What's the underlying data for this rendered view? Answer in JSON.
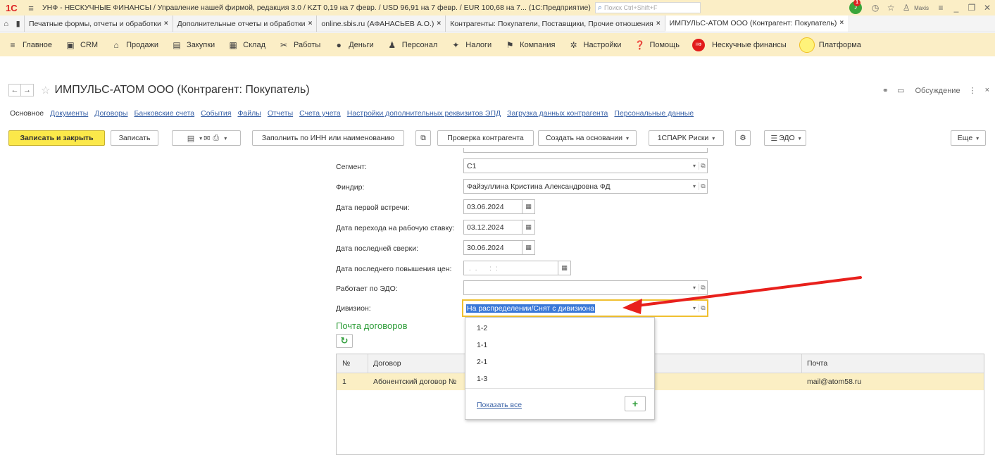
{
  "titlebar": {
    "app_logo": "1С",
    "text": "УНФ - НЕСКУЧНЫЕ ФИНАНСЫ / Управление нашей фирмой, редакция 3.0 / KZT 0,19 на 7 февр. / USD 96,91 на 7 февр. / EUR 100,68 на 7...  (1С:Предприятие)",
    "search_placeholder": "Поиск Ctrl+Shift+F",
    "notification_count": "1",
    "user": "Maxis"
  },
  "tabs": [
    {
      "label": "Печатные формы, отчеты и обработки"
    },
    {
      "label": "Дополнительные отчеты и обработки"
    },
    {
      "label": "online.sbis.ru (АФАНАСЬЕВ А.О.)"
    },
    {
      "label": "Контрагенты: Покупатели, Поставщики, Прочие отношения"
    },
    {
      "label": "ИМПУЛЬС-АТОМ ООО (Контрагент: Покупатель)"
    }
  ],
  "sections": [
    {
      "label": "Главное"
    },
    {
      "label": "CRM"
    },
    {
      "label": "Продажи"
    },
    {
      "label": "Закупки"
    },
    {
      "label": "Склад"
    },
    {
      "label": "Работы"
    },
    {
      "label": "Деньги"
    },
    {
      "label": "Персонал"
    },
    {
      "label": "Налоги"
    },
    {
      "label": "Компания"
    },
    {
      "label": "Настройки"
    },
    {
      "label": "Помощь"
    },
    {
      "label": "Нескучные финансы",
      "badge": "НФ"
    },
    {
      "label": "Платформа"
    }
  ],
  "form": {
    "title": "ИМПУЛЬС-АТОМ ООО (Контрагент: Покупатель)",
    "discussion": "Обсуждение"
  },
  "subnav": {
    "current": "Основное",
    "links": [
      "Документы",
      "Договоры",
      "Банковские счета",
      "События",
      "Файлы",
      "Отчеты",
      "Счета учета",
      "Настройки дополнительных реквизитов ЭПД",
      "Загрузка данных контрагента",
      "Персональные данные"
    ]
  },
  "toolbar": {
    "save_close": "Записать и закрыть",
    "save": "Записать",
    "fill_inn": "Заполнить по ИНН или наименованию",
    "check": "Проверка контрагента",
    "create_based": "Создать на основании",
    "spark": "1СПАРК Риски",
    "edo": "ЭДО",
    "more": "Еще"
  },
  "fields": {
    "segment": {
      "label": "Сегмент:",
      "value": "С1"
    },
    "findir": {
      "label": "Финдир:",
      "value": "Файзуллина Кристина Александровна ФД"
    },
    "first_meeting": {
      "label": "Дата первой встречи:",
      "value": "03.06.2024"
    },
    "work_rate": {
      "label": "Дата перехода на рабочую ставку:",
      "value": "03.12.2024"
    },
    "last_reconcile": {
      "label": "Дата последней сверки:",
      "value": "30.06.2024"
    },
    "last_price_raise": {
      "label": "Дата последнего повышения цен:",
      "value": " .  .      :  :"
    },
    "edo_works": {
      "label": "Работает по ЭДО:",
      "value": ""
    },
    "division": {
      "label": "Дивизион:",
      "value": "На распределении/Снят с дивизиона"
    }
  },
  "contracts": {
    "title": "Почта договоров",
    "columns": [
      "№",
      "Договор",
      "Почта"
    ],
    "rows": [
      {
        "n": "1",
        "contract": "Абонентский договор №",
        "email": "mail@atom58.ru"
      }
    ]
  },
  "dropdown": {
    "items": [
      "1-2",
      "1-1",
      "2-1",
      "1-3"
    ],
    "show_all": "Показать все"
  },
  "colors": {
    "accent_yellow": "#fbe84a",
    "section_bg": "#fbeec6",
    "link": "#3b63a7",
    "green_title": "#2f9d3a",
    "selection": "#3a78d8",
    "arrow": "#e8201c"
  }
}
